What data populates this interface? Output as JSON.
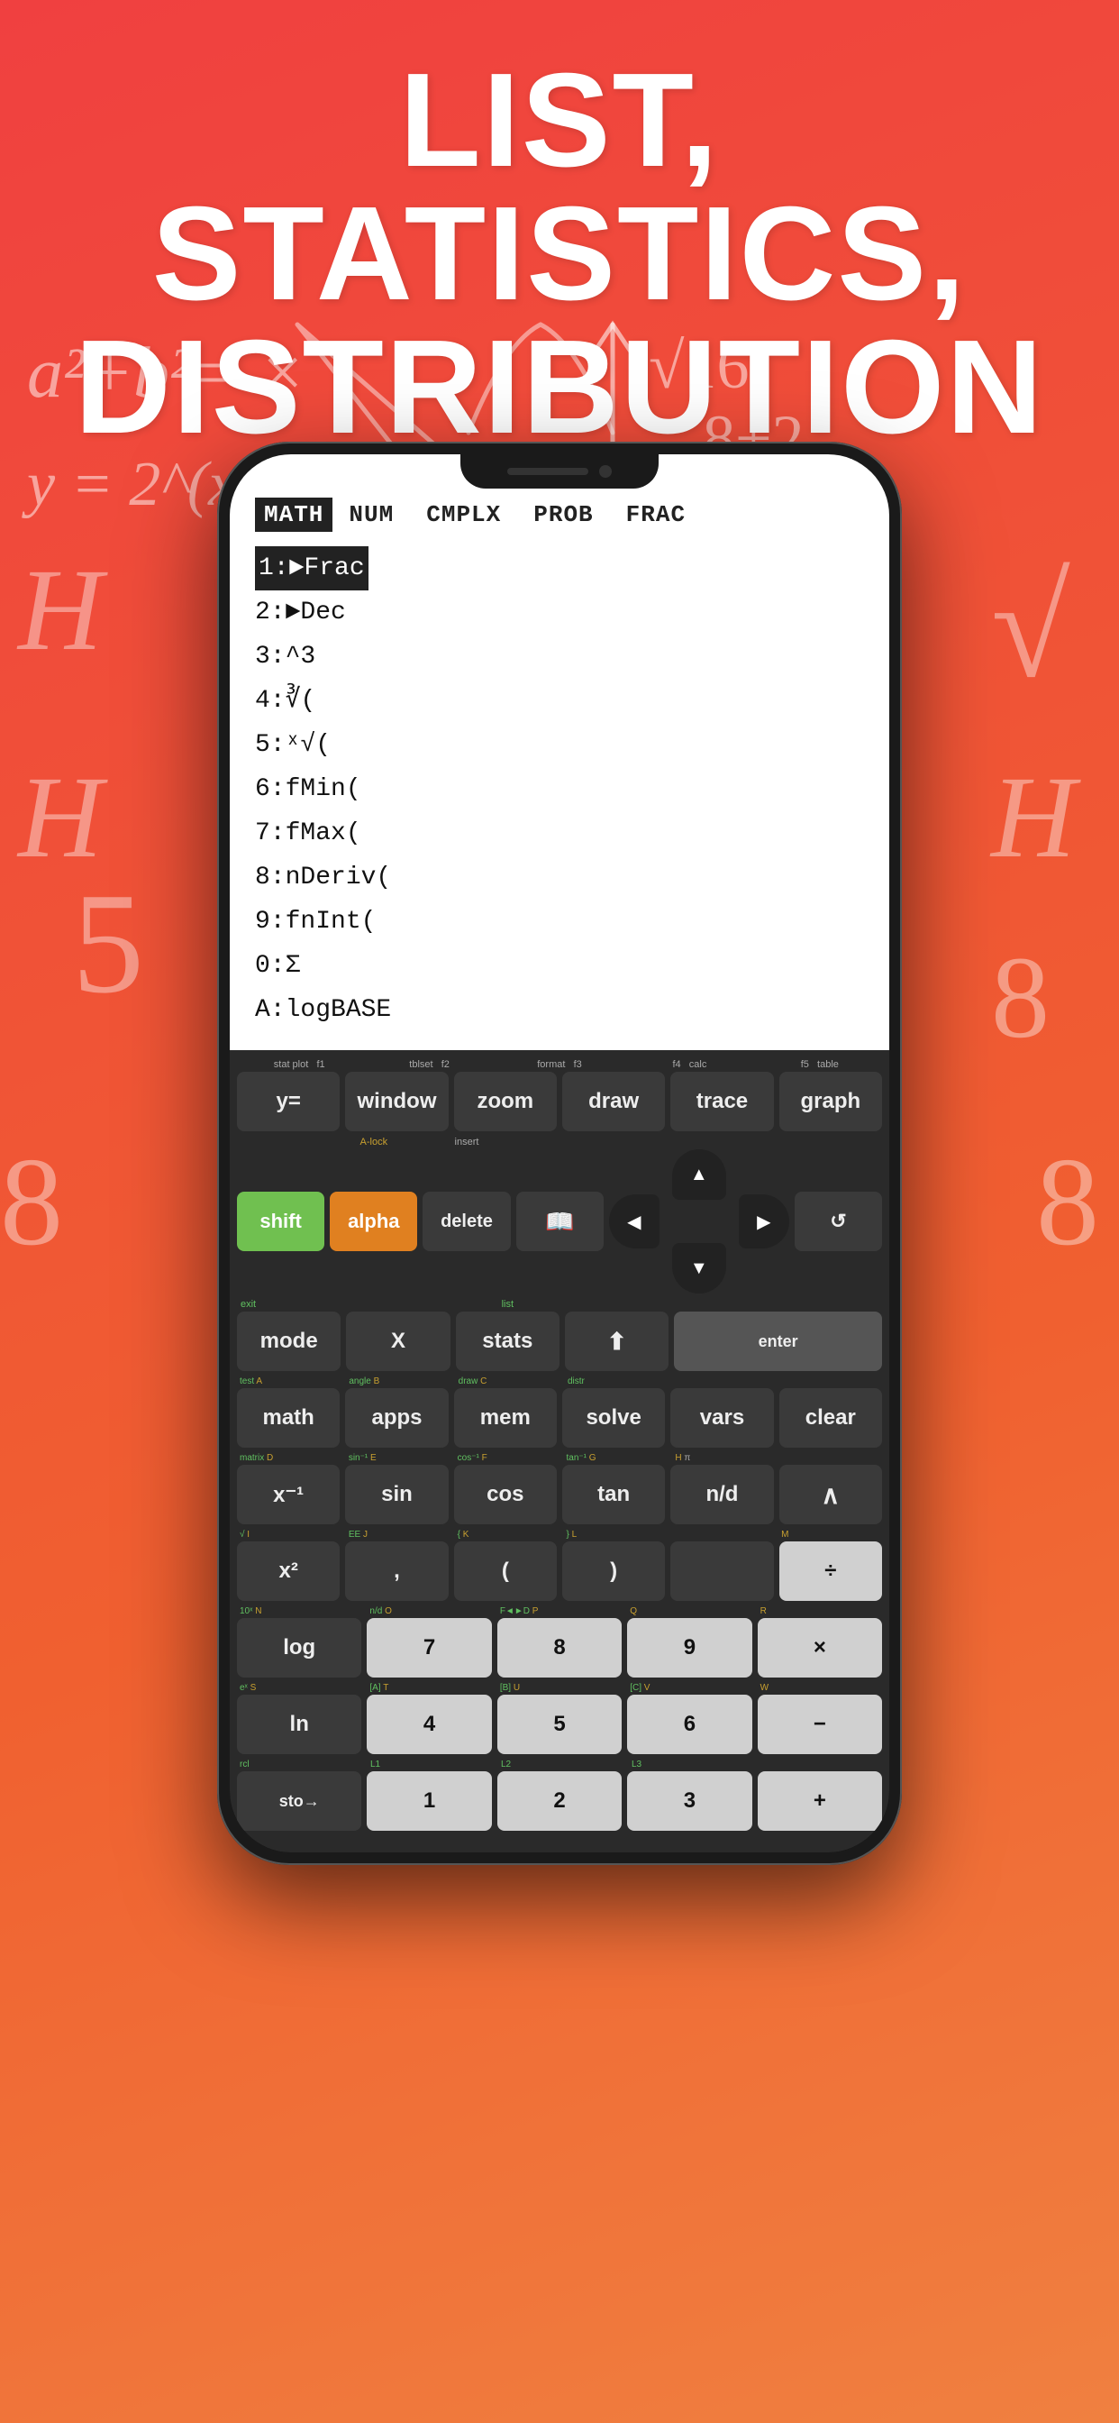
{
  "header": {
    "line1": "LIST, STATISTICS,",
    "line2": "DISTRIBUTION"
  },
  "phone": {
    "screen": {
      "menu_bar": {
        "items": [
          "MATH",
          "NUM",
          "CMPLX",
          "PROB",
          "FRAC"
        ],
        "active_index": 0
      },
      "menu_list": [
        {
          "num": "1:",
          "label": "►Frac",
          "selected": true
        },
        {
          "num": "2:",
          "label": "►Dec"
        },
        {
          "num": "3:",
          "label": "^3"
        },
        {
          "num": "4:",
          "label": "∛("
        },
        {
          "num": "5:",
          "label": "ˣ√("
        },
        {
          "num": "6:",
          "label": "fMin("
        },
        {
          "num": "7:",
          "label": "fMax("
        },
        {
          "num": "8:",
          "label": "nDeriv("
        },
        {
          "num": "9:",
          "label": "fnInt("
        },
        {
          "num": "0:",
          "label": "Σ"
        },
        {
          "num": "A:",
          "label": "logBASE"
        }
      ]
    },
    "keyboard": {
      "fn_row": [
        {
          "sub": "stat plot",
          "label": "y="
        },
        {
          "sub": "tblset",
          "label": "window"
        },
        {
          "sub": "format",
          "label": "zoom"
        },
        {
          "sub": "",
          "label": "draw"
        },
        {
          "sub": "f4 calc",
          "label": "trace"
        },
        {
          "sub": "f5 table",
          "label": "graph"
        }
      ],
      "row2_labels": {
        "shift_top": "",
        "alpha_top": "A-lock",
        "insert_label": "insert"
      },
      "row2": [
        {
          "label": "shift",
          "type": "green"
        },
        {
          "label": "alpha",
          "type": "orange"
        },
        {
          "label": "delete",
          "type": "dark"
        },
        {
          "label": "📖",
          "type": "dark"
        },
        {
          "label": "↑",
          "type": "dpad-up"
        },
        {
          "label": "↺",
          "type": "dark"
        }
      ],
      "row3_labels": {
        "exit": "exit",
        "list": "list"
      },
      "row3": [
        {
          "label": "mode",
          "type": "dark"
        },
        {
          "label": "X",
          "type": "dark"
        },
        {
          "label": "stats",
          "type": "dark"
        },
        {
          "label": "⬆",
          "type": "dark"
        },
        {
          "label": "↩",
          "type": "dark"
        }
      ],
      "row4_labels": {
        "test_A": "test  A",
        "angle_B": "angle  B",
        "draw_C": "draw  C",
        "distr": "distr"
      },
      "row4": [
        {
          "label": "math",
          "sub_green": "test",
          "sub_letter": "A",
          "type": "dark"
        },
        {
          "label": "apps",
          "sub_green": "angle",
          "sub_letter": "B",
          "type": "dark"
        },
        {
          "label": "mem",
          "sub_green": "draw",
          "sub_letter": "C",
          "type": "dark"
        },
        {
          "label": "solve",
          "sub_green": "distr",
          "type": "dark"
        },
        {
          "label": "vars",
          "type": "dark"
        },
        {
          "label": "clear",
          "type": "dark"
        }
      ],
      "row5_labels": "matrix D | sin⁻¹ E | cos⁻¹ F | tan⁻¹ G | H π",
      "row5": [
        {
          "label": "x⁻¹",
          "sub_green": "matrix",
          "sub_letter": "D",
          "type": "dark"
        },
        {
          "label": "sin",
          "sub_green": "sin⁻¹",
          "sub_letter": "E",
          "type": "dark"
        },
        {
          "label": "cos",
          "sub_green": "cos⁻¹",
          "sub_letter": "F",
          "type": "dark"
        },
        {
          "label": "tan",
          "sub_green": "tan⁻¹",
          "sub_letter": "G",
          "type": "dark"
        },
        {
          "label": "n/d",
          "sub_green": "H",
          "sub_sym": "π",
          "type": "dark"
        },
        {
          "label": "∧",
          "type": "dark"
        }
      ],
      "row6_labels": "√ | I EE | J { | K } | L | M",
      "row6": [
        {
          "label": "x²",
          "sub_green": "√",
          "sub_letter": "I",
          "type": "dark"
        },
        {
          "label": ",",
          "sub_green": "EE",
          "sub_letter": "J",
          "type": "dark"
        },
        {
          "label": "(",
          "sub_green": "{",
          "sub_letter": "K",
          "type": "dark"
        },
        {
          "label": ")",
          "sub_green": "}",
          "sub_letter": "L",
          "type": "dark"
        },
        {
          "label": "",
          "type": "dark"
        },
        {
          "label": "÷",
          "sub_letter": "M",
          "type": "light"
        }
      ],
      "row7_labels": "10ˣ N | n/d O | F◄►D P | Q | R",
      "row7": [
        {
          "label": "log",
          "sub_green": "10ˣ",
          "sub_letter": "N",
          "type": "dark"
        },
        {
          "label": "7",
          "sub_green": "n/d",
          "sub_letter": "O",
          "type": "light"
        },
        {
          "label": "8",
          "sub_green": "F◄►D",
          "sub_letter": "P",
          "type": "light"
        },
        {
          "label": "9",
          "sub_letter": "Q",
          "type": "light"
        },
        {
          "label": "×",
          "sub_letter": "R",
          "type": "light"
        }
      ],
      "row8_labels": "eˣ S | [A] T | [B] U | [C] V | W",
      "row8": [
        {
          "label": "ln",
          "sub_green": "eˣ",
          "sub_letter": "S",
          "type": "dark"
        },
        {
          "label": "4",
          "sub_green": "[A]",
          "sub_letter": "T",
          "type": "light"
        },
        {
          "label": "5",
          "sub_green": "[B]",
          "sub_letter": "U",
          "type": "light"
        },
        {
          "label": "6",
          "sub_green": "[C]",
          "sub_letter": "V",
          "type": "light"
        },
        {
          "label": "−",
          "sub_letter": "W",
          "type": "light"
        }
      ],
      "row9_labels": "rcl | L1 | L2 | L3",
      "row9": [
        {
          "label": "sto→",
          "sub_green": "rcl",
          "type": "dark"
        },
        {
          "label": "1",
          "sub_green": "L1",
          "type": "light"
        },
        {
          "label": "2",
          "sub_green": "L2",
          "type": "light"
        },
        {
          "label": "3",
          "sub_green": "L3",
          "type": "light"
        },
        {
          "label": "+",
          "type": "light"
        }
      ]
    }
  }
}
